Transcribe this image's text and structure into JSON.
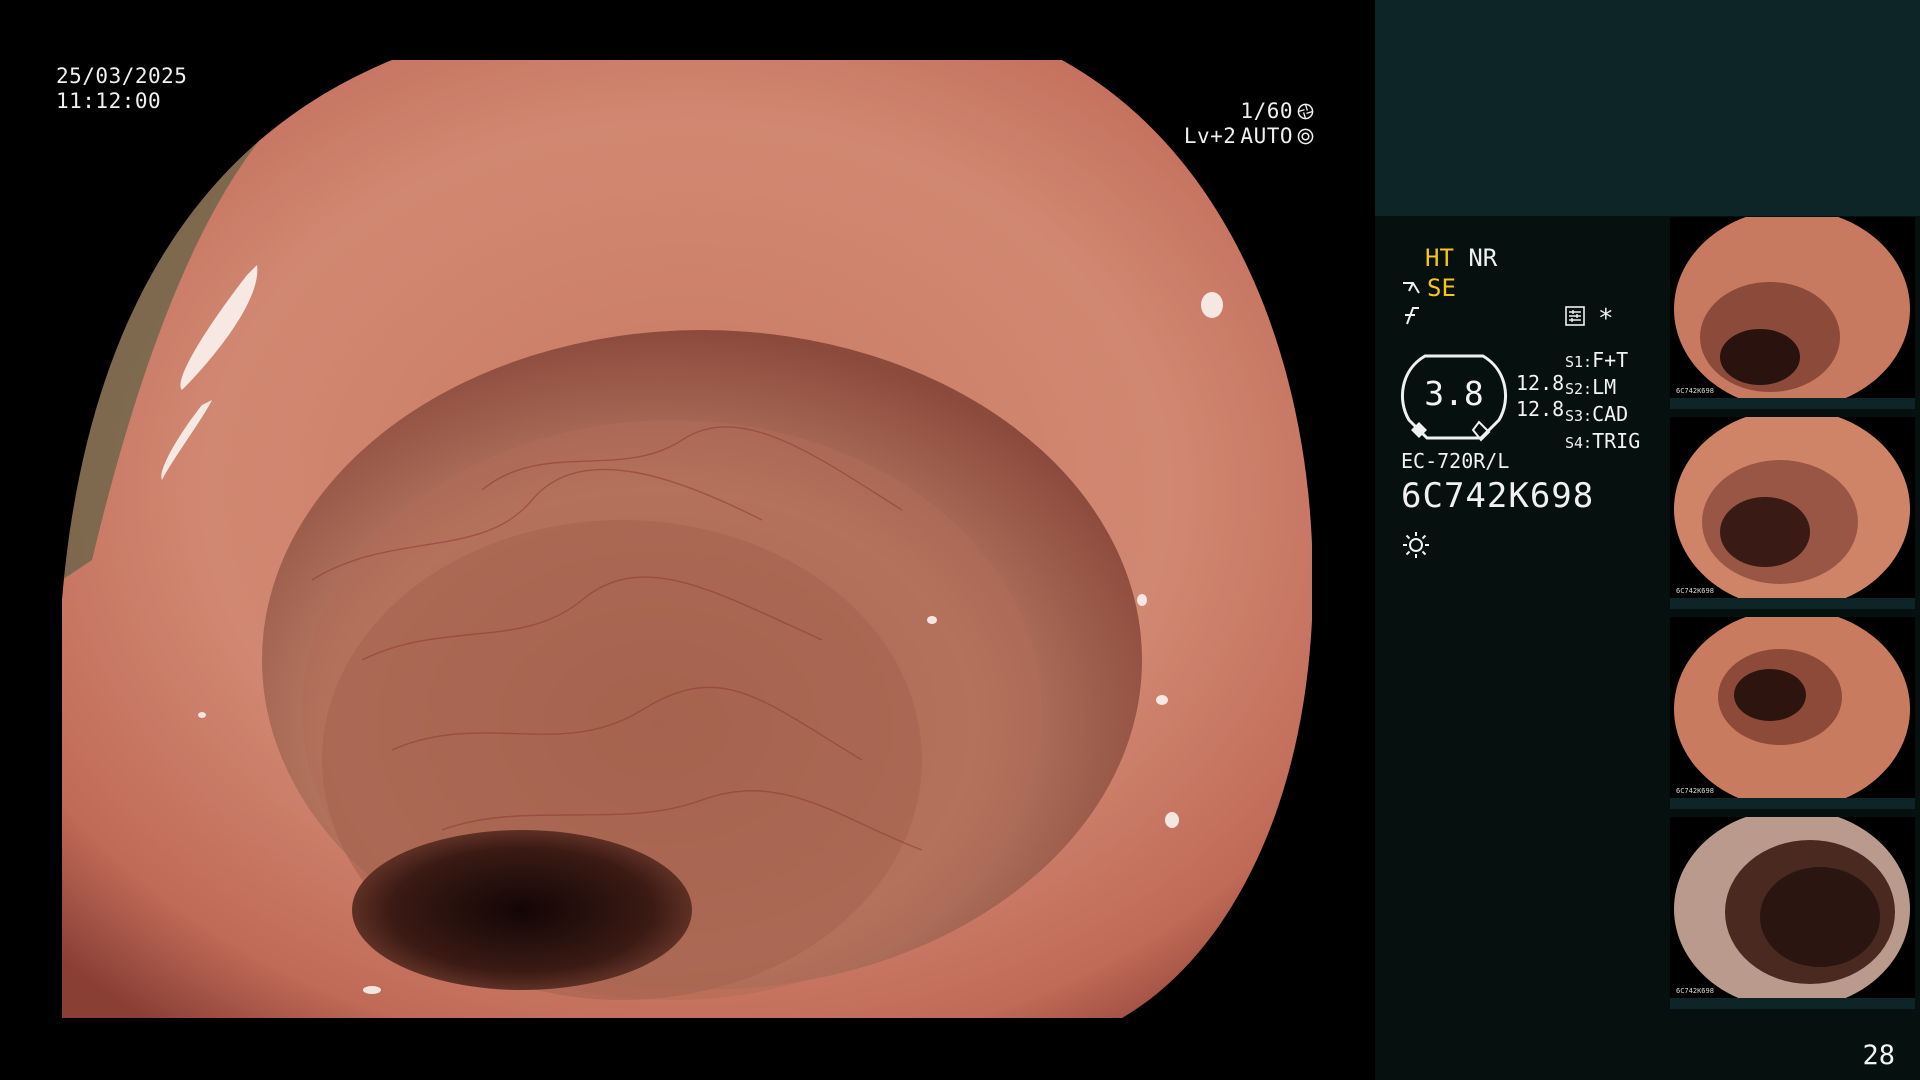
{
  "overlay": {
    "date": "25/03/2025",
    "time": "11:12:00",
    "shutter": "1/60",
    "level": "Lv+2",
    "mode": "AUTO"
  },
  "panel": {
    "ht": "HT",
    "nr": "NR",
    "se": "SE",
    "zoom_value": "3.8",
    "values": [
      "12.8",
      "12.8"
    ],
    "slots": [
      {
        "key": "S1:",
        "value": "F+T"
      },
      {
        "key": "S2:",
        "value": "LM"
      },
      {
        "key": "S3:",
        "value": "CAD"
      },
      {
        "key": "S4:",
        "value": "TRIG"
      }
    ],
    "scope_model": "EC-720R/L",
    "scope_serial": "6C742K698",
    "page_number": "28",
    "colors": {
      "highlight": "#f5c518",
      "panel_top": "#0e2527",
      "panel": "#06100f"
    }
  },
  "thumbnails": [
    {
      "caption": "6C742K698",
      "lumen": "left-low"
    },
    {
      "caption": "6C742K698",
      "lumen": "left-mid"
    },
    {
      "caption": "6C742K698",
      "lumen": "center-left"
    },
    {
      "caption": "6C742K698",
      "lumen": "center-right"
    }
  ]
}
